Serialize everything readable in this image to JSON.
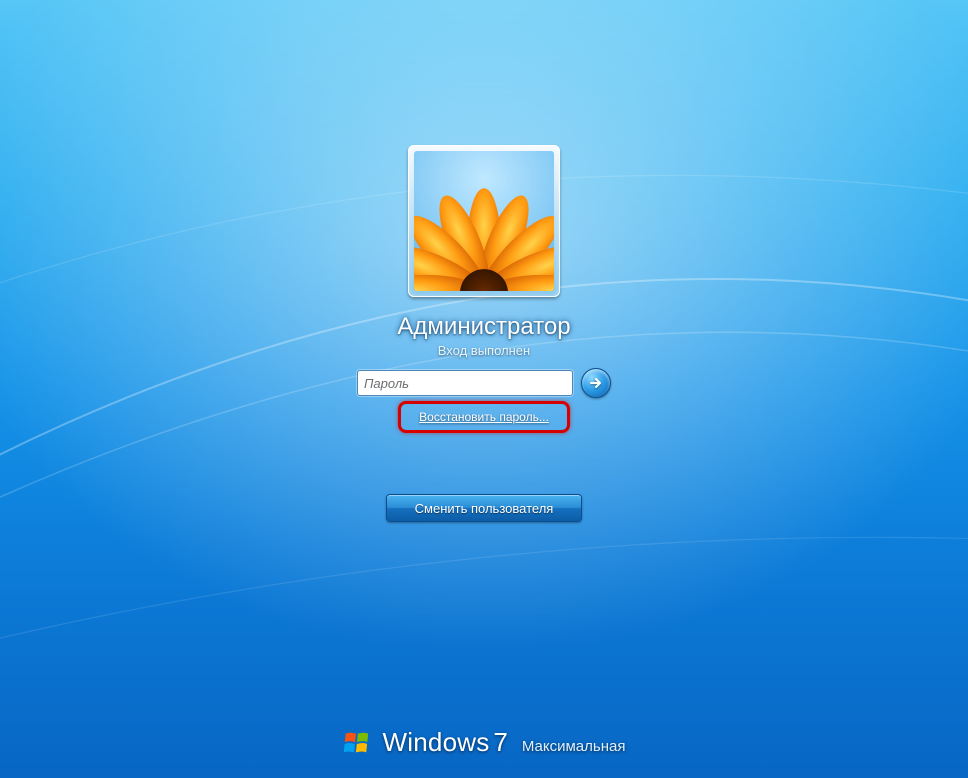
{
  "user": {
    "name": "Администратор",
    "status": "Вход выполнен"
  },
  "password": {
    "placeholder": "Пароль",
    "value": ""
  },
  "links": {
    "reset_password": "Восстановить пароль..."
  },
  "buttons": {
    "switch_user": "Сменить пользователя"
  },
  "branding": {
    "product": "Windows",
    "version": "7",
    "edition": "Максимальная"
  },
  "icons": {
    "avatar": "flower-avatar",
    "submit": "arrow-right-icon",
    "logo": "windows-logo-icon"
  },
  "highlight": {
    "target": "reset-password-link"
  }
}
